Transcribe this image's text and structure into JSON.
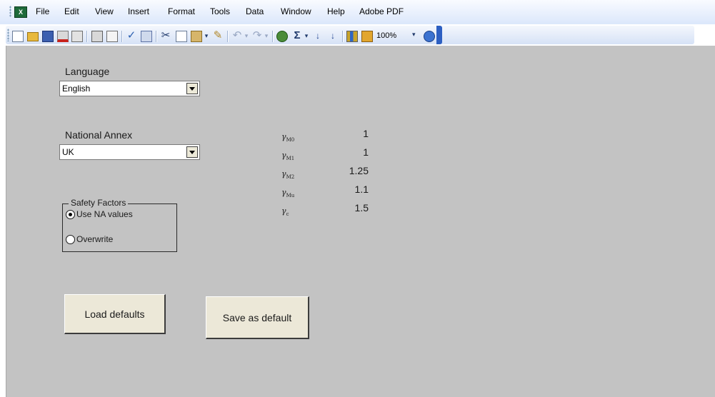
{
  "menu": {
    "items": [
      "File",
      "Edit",
      "View",
      "Insert",
      "Format",
      "Tools",
      "Data",
      "Window",
      "Help",
      "Adobe PDF"
    ]
  },
  "toolbar": {
    "zoom": "100%"
  },
  "language": {
    "label": "Language",
    "selected": "English"
  },
  "national_annex": {
    "label": "National Annex",
    "selected": "UK"
  },
  "safety_factors": {
    "title": "Safety Factors",
    "options": [
      {
        "label": "Use NA values",
        "selected": true
      },
      {
        "label": "Overwrite",
        "selected": false
      }
    ]
  },
  "factors": [
    {
      "symbol": "γ",
      "subscript": "M0",
      "value": "1"
    },
    {
      "symbol": "γ",
      "subscript": "M1",
      "value": "1"
    },
    {
      "symbol": "γ",
      "subscript": "M2",
      "value": "1.25"
    },
    {
      "symbol": "γ",
      "subscript": "Mu",
      "value": "1.1"
    },
    {
      "symbol": "γ",
      "subscript": "c",
      "value": "1.5"
    }
  ],
  "buttons": {
    "load_defaults": "Load defaults",
    "save_as_default": "Save as default"
  },
  "colors": {
    "sheet_background": "#c3c3c3",
    "button_face": "#ece8d8",
    "toolbar_accent": "#2d5fc2"
  }
}
